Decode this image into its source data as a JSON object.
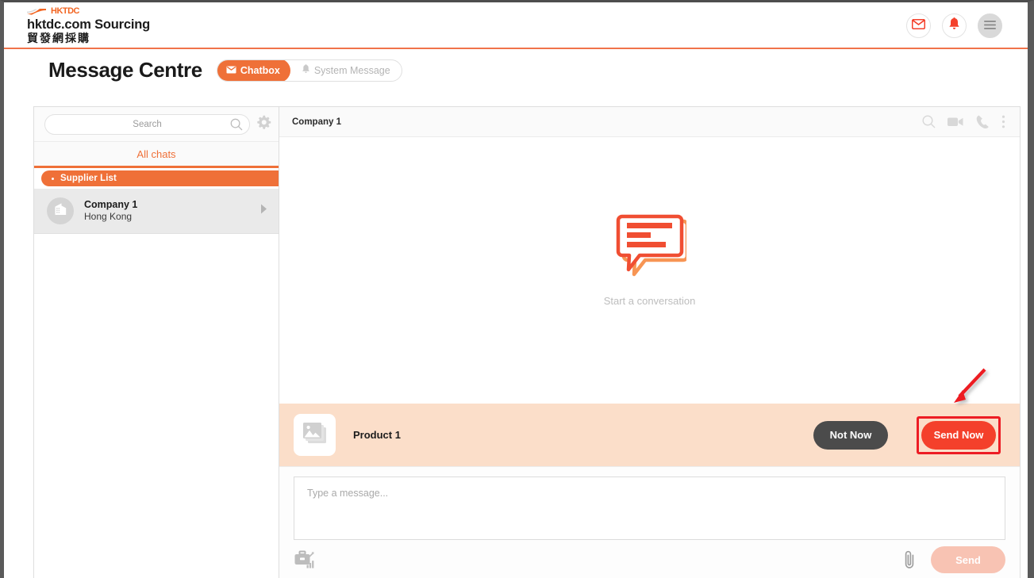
{
  "header": {
    "brand_mark": "HKTDC",
    "brand_name": "hktdc.com Sourcing",
    "brand_name_cn": "貿發網採購",
    "actions": [
      {
        "name": "mail-icon",
        "label": "Mail"
      },
      {
        "name": "bell-icon",
        "label": "Notifications"
      },
      {
        "name": "menu-icon",
        "label": "Menu"
      }
    ]
  },
  "page": {
    "title": "Message Centre",
    "tabs": [
      {
        "label": "Chatbox",
        "icon": "envelope-icon",
        "active": true
      },
      {
        "label": "System Message",
        "icon": "bell-icon",
        "active": false
      }
    ]
  },
  "sidebar": {
    "search": {
      "value": "",
      "placeholder": "Search"
    },
    "settings_icon": "gear-icon",
    "all_chats_label": "All chats",
    "group_label": "Supplier List",
    "chats": [
      {
        "name": "Company 1",
        "location": "Hong Kong"
      }
    ]
  },
  "conversation": {
    "title": "Company 1",
    "header_icons": [
      {
        "name": "search-icon"
      },
      {
        "name": "video-camera-icon"
      },
      {
        "name": "phone-icon"
      },
      {
        "name": "more-vertical-icon"
      }
    ],
    "empty_state": {
      "caption": "Start a conversation",
      "icon": "chat-bubble-icon"
    },
    "product_bar": {
      "thumbnail_icon": "image-stack-icon",
      "product_name": "Product 1",
      "not_now_label": "Not Now",
      "send_now_label": "Send Now",
      "highlighted": "send-now-button"
    },
    "composer": {
      "placeholder": "Type a message...",
      "value": "",
      "catalog_icon": "briefcase-chart-icon",
      "attach_icon": "paperclip-icon",
      "send_label": "Send"
    }
  },
  "colors": {
    "brand_orange": "#ef7038",
    "logo_orange": "#f26522",
    "accent_red": "#f4402b",
    "highlight_red": "#ed1c24",
    "product_bar_bg": "#fbdec9",
    "send_disabled": "#f8c3b3",
    "dark_button": "#4b4b4b"
  }
}
